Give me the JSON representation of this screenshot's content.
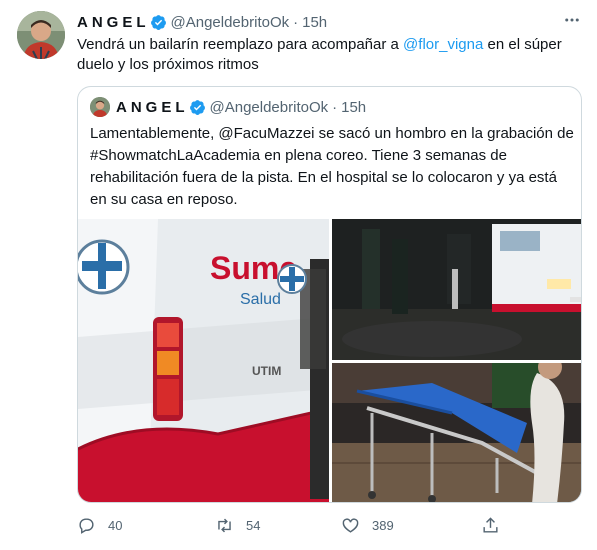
{
  "tweet": {
    "author_name": "ANGEL",
    "handle": "@AngeldebritoOk",
    "separator": "·",
    "time": "15h",
    "more_icon": "more-horizontal-icon",
    "text_before": "Vendrá un bailarín reemplazo para acompañar a ",
    "mention": "@flor_vigna",
    "text_after": " en el súper duelo y los próximos ritmos"
  },
  "quote": {
    "author_name": "ANGEL",
    "handle": "@AngeldebritoOk",
    "separator": "·",
    "time": "15h",
    "text": "Lamentablemente, @FacuMazzei se sacó un hombro en la grabación de #ShowmatchLaAcademia en plena coreo. Tiene 3 semanas de rehabilitación fuera de la pista. En el hospital se lo colocaron y ya está en su casa en reposo.",
    "ambulance_text": "Sume",
    "ambulance_subtext": "Salud",
    "ambulance_small": "UTIM"
  },
  "actions": {
    "replies": "40",
    "retweets": "54",
    "likes": "389"
  },
  "colors": {
    "accent": "#1d9bf0",
    "muted": "#536471",
    "border": "#cfd9de",
    "ambulance_red": "#c8102e"
  }
}
